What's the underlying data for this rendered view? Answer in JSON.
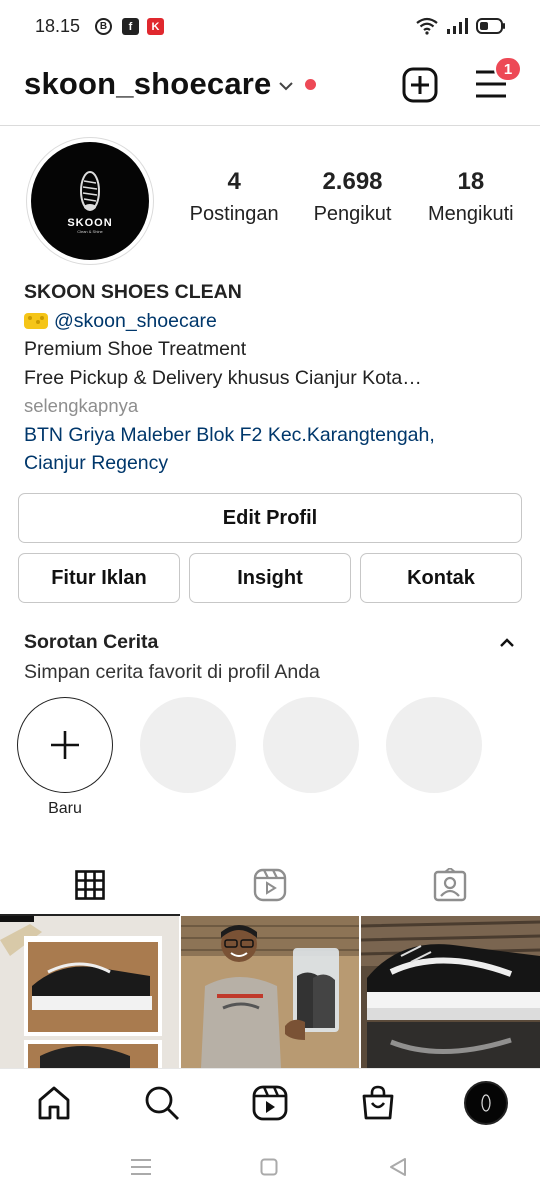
{
  "status_bar": {
    "time": "18.15",
    "apps": [
      "B",
      "f",
      "K"
    ],
    "icons": [
      "wifi-icon",
      "signal-icon",
      "battery-icon"
    ]
  },
  "header": {
    "username": "skoon_shoecare",
    "notification_count": "1",
    "icons": [
      "chevron-down-icon",
      "add-post-icon",
      "menu-icon"
    ]
  },
  "avatar": {
    "brand": "SKOON",
    "tagline": "Clean & Shine"
  },
  "stats": [
    {
      "value": "4",
      "label": "Postingan"
    },
    {
      "value": "2.698",
      "label": "Pengikut"
    },
    {
      "value": "18",
      "label": "Mengikuti"
    }
  ],
  "bio": {
    "name": "SKOON SHOES CLEAN",
    "handle": "@skoon_shoecare",
    "line1": "Premium Shoe Treatment",
    "line2": "Free Pickup & Delivery khusus Cianjur Kota…",
    "more": "selengkapnya",
    "location_line1": "BTN Griya Maleber Blok F2 Kec.Karangtengah,",
    "location_line2": "Cianjur Regency"
  },
  "buttons": {
    "edit_profile": "Edit Profil",
    "ads": "Fitur Iklan",
    "insight": "Insight",
    "contact": "Kontak"
  },
  "highlights": {
    "title": "Sorotan Cerita",
    "subtitle": "Simpan cerita favorit di profil Anda",
    "new_label": "Baru"
  },
  "tabs": [
    "grid-icon",
    "reels-icon",
    "tagged-icon"
  ],
  "bottom_nav": [
    "home-icon",
    "search-icon",
    "reels-icon",
    "shop-icon",
    "profile-avatar"
  ],
  "colors": {
    "link": "#00376b",
    "badge": "#ed4956",
    "muted": "#8e8e8e",
    "border": "#dbdbdb"
  }
}
